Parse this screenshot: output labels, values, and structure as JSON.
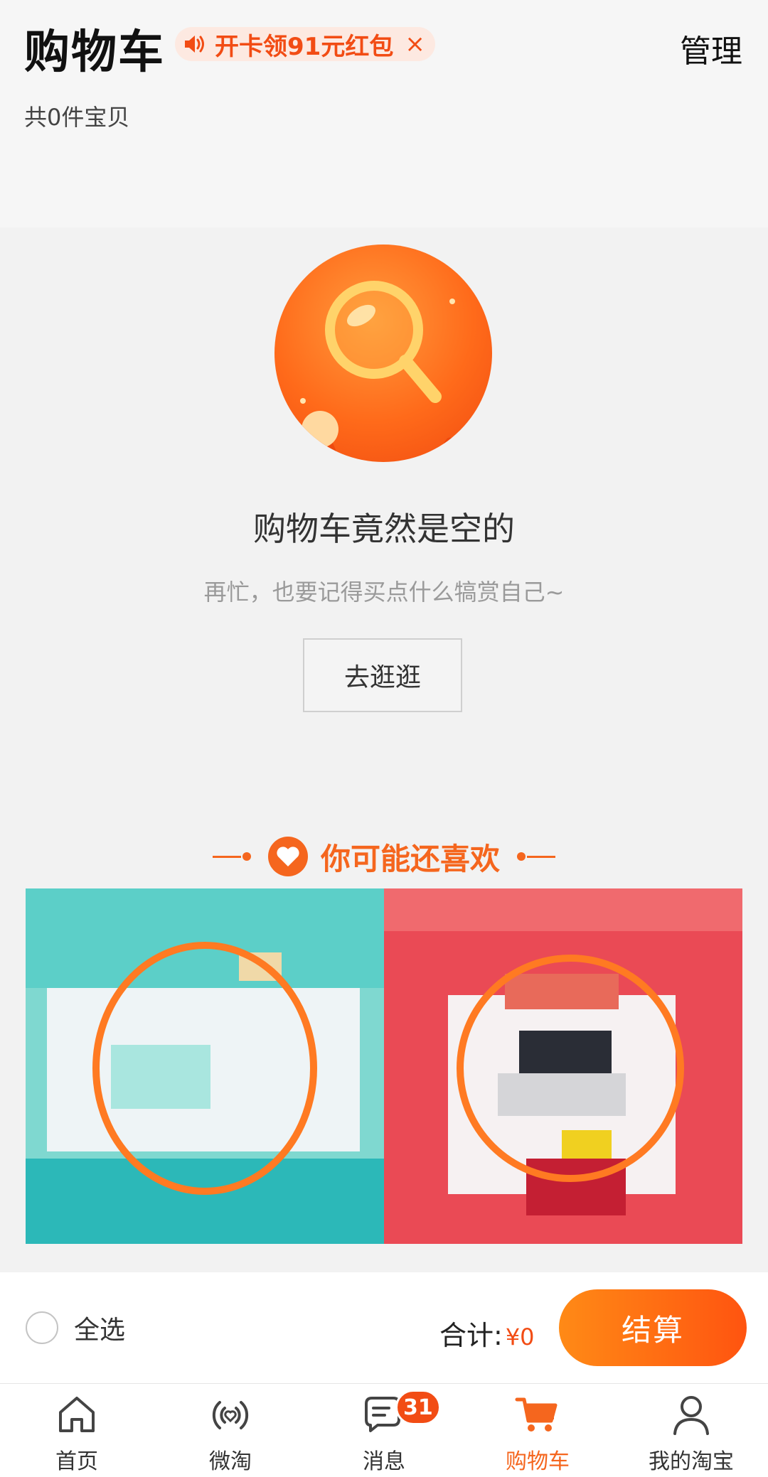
{
  "header": {
    "title": "购物车",
    "promo_text": "开卡领91元红包",
    "promo_close": "×",
    "manage_label": "管理",
    "item_count_text": "共0件宝贝"
  },
  "empty_state": {
    "illustration_icon": "magnifier-illustration",
    "title": "购物车竟然是空的",
    "subtitle": "再忙，也要记得买点什么犒赏自己~",
    "button_label": "去逛逛"
  },
  "recommend": {
    "heading": "你可能还喜欢",
    "icon": "heart-icon",
    "products": [
      {
        "name": "product-1",
        "theme_color": "#3fc2c0",
        "highlight_color": "#ff7a22"
      },
      {
        "name": "product-2",
        "theme_color": "#ea4a55",
        "highlight_color": "#ff7a22"
      }
    ]
  },
  "checkout_bar": {
    "select_all_label": "全选",
    "total_label": "合计:",
    "total_amount": "¥0",
    "checkout_label": "结算"
  },
  "tabbar": {
    "active_color": "#f5661e",
    "items": [
      {
        "label": "首页",
        "icon": "home-icon"
      },
      {
        "label": "微淘",
        "icon": "feed-icon"
      },
      {
        "label": "消息",
        "icon": "message-icon",
        "badge": "31"
      },
      {
        "label": "购物车",
        "icon": "cart-icon",
        "active": true
      },
      {
        "label": "我的淘宝",
        "icon": "profile-icon"
      }
    ]
  }
}
